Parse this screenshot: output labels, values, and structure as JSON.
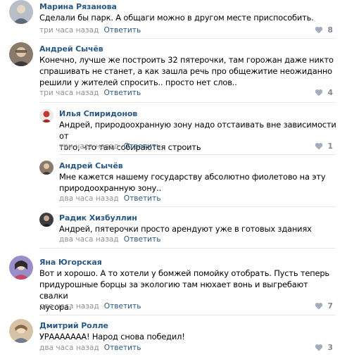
{
  "comments": [
    {
      "author": "Марина Рязанова",
      "lines": [
        "Сделали бы парк. А общаги можно в другом месте приспособить."
      ],
      "time": "три часа назад",
      "reply": "Ответить",
      "likes": "8",
      "avatar_color": "#b0b4b9"
    },
    {
      "author": "Андрей Сычёв",
      "lines": [
        "Конечно, лучше же построить 32 пятерочки, там горожан даже никто",
        "спрашивать не станет, а как зашла речь про общежитие неожиданно",
        "решили у жителей спросить.. просто нет слов.."
      ],
      "time": "три часа назад",
      "reply": "Ответить",
      "likes": "4",
      "avatar_color": "#6b5a4a"
    },
    {
      "author": "Илья Спиридонов",
      "lines": [
        "Андрей, природоохранную зону надо отстаивать вне зависимости от",
        "того, что там собираются строить"
      ],
      "time": "три часа назад",
      "reply": "Ответить",
      "likes": "1",
      "avatar_color": "#c0392b"
    },
    {
      "author": "Андрей Сычёв",
      "lines": [
        "Мне кажется нашему государству абсолютно фиолетово на эту",
        "природоохранную зону.."
      ],
      "time": "два часа назад",
      "reply": "Ответить",
      "likes": "",
      "avatar_color": "#6b5a4a"
    },
    {
      "author": "Радик Хизбуллин",
      "lines": [
        "Андрей, пятерочки просто арендуют уже в готовых зданиях"
      ],
      "time": "два часа назад",
      "reply": "Ответить",
      "likes": "",
      "avatar_color": "#4a4a52"
    },
    {
      "author": "Яна Югорская",
      "lines": [
        "Вот и хорошо. А то хотели у бомжей помойку отобрать. Пусть теперь",
        "придурошные борцы за экологию там нюхает вонь и выгребают свалки",
        "мусора."
      ],
      "time": "два часа назад",
      "reply": "Ответить",
      "likes": "7",
      "avatar_color": "#8e7cc3"
    },
    {
      "author": "Дмитрий Ролле",
      "lines": [
        "УРААААААА! Народ снова победил!"
      ],
      "time": "два часа назад",
      "reply": "Ответить",
      "likes": "3",
      "avatar_color": "#c9a27e"
    }
  ],
  "colors": {
    "link": "#2a5885",
    "meta": "#939393",
    "like": "#828a99",
    "divider": "#e7e8ec"
  },
  "icons": {
    "like": "heart-icon"
  }
}
